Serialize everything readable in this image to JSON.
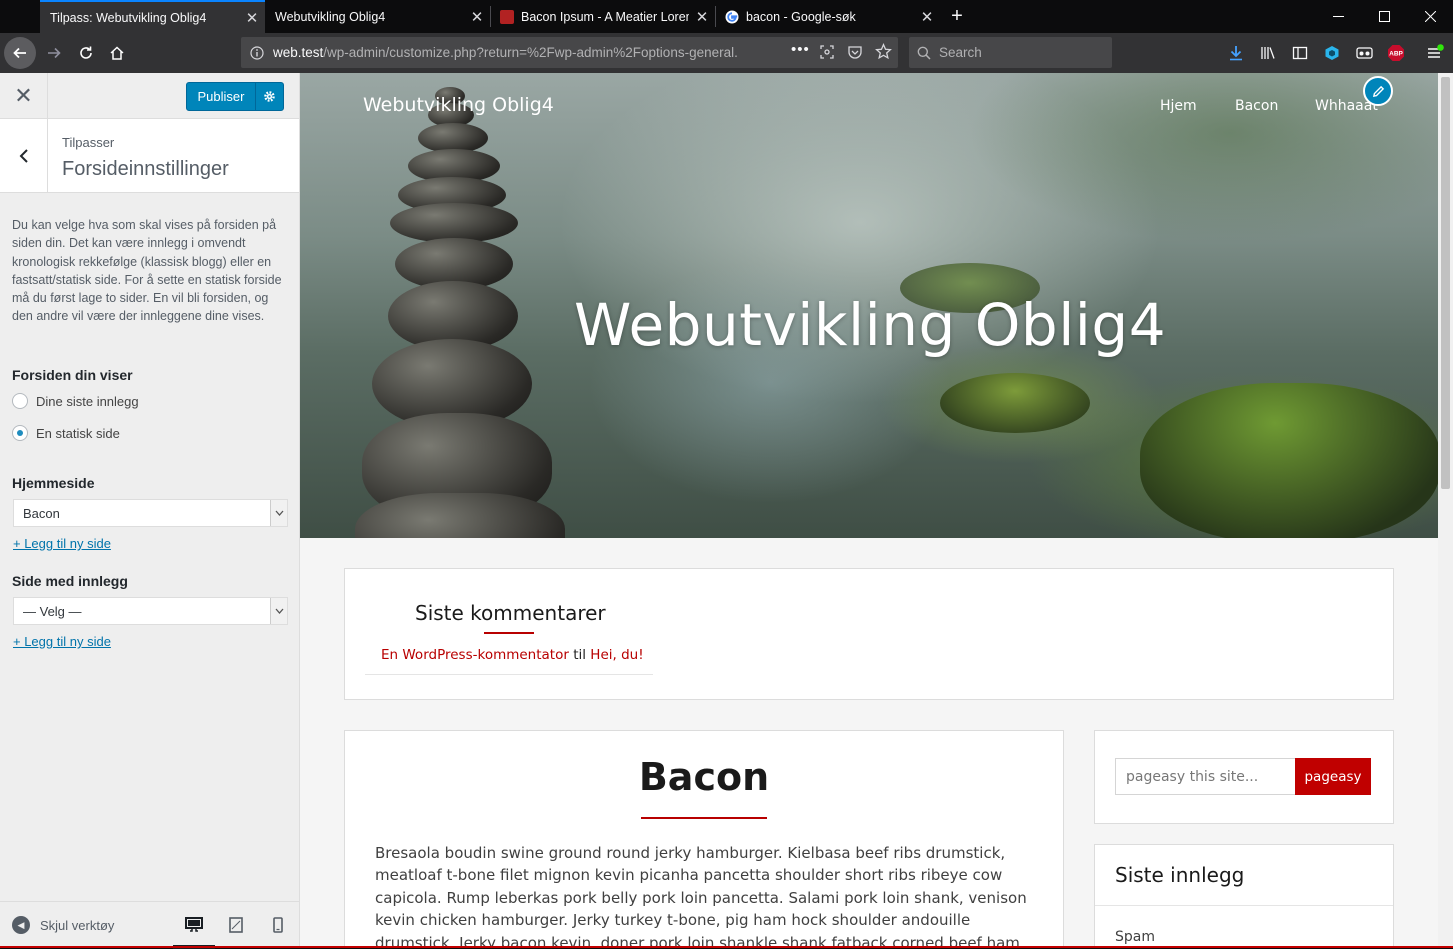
{
  "browser": {
    "tabs": [
      {
        "label": "Tilpass: Webutvikling Oblig4",
        "active": true
      },
      {
        "label": "Webutvikling Oblig4",
        "active": false
      },
      {
        "label": "Bacon Ipsum - A Meatier Lorem",
        "active": false
      },
      {
        "label": "bacon - Google-søk",
        "active": false
      }
    ],
    "url": "web.test/wp-admin/customize.php?return=%2Fwp-admin%2Foptions-general.",
    "url_domain": "web.test",
    "url_path": "/wp-admin/customize.php?return=%2Fwp-admin%2Foptions-general.",
    "search_placeholder": "Search",
    "new_tab_glyph": "+",
    "close_glyph": "✕"
  },
  "customizer": {
    "close_glyph": "✕",
    "publish_label": "Publiser",
    "breadcrumb": "Tilpasser",
    "section_title": "Forsideinnstillinger",
    "description": "Du kan velge hva som skal vises på forsiden på siden din. Det kan være innlegg i omvendt kronologisk rekkefølge (klassisk blogg) eller en fastsatt/statisk side. For å sette en statisk forside må du først lage to sider. En vil bli forsiden, og den andre vil være der innleggene dine vises.",
    "front_label": "Forsiden din viser",
    "radio_latest": "Dine siste innlegg",
    "radio_static": "En statisk side",
    "selected_radio": "static",
    "homepage_label": "Hjemmeside",
    "homepage_value": "Bacon",
    "add_page_link": "+ Legg til ny side",
    "posts_page_label": "Side med innlegg",
    "posts_page_value": "— Velg —",
    "add_page_link_2": "+ Legg til ny side",
    "hide_controls": "Skjul verktøy",
    "active_device": "desktop"
  },
  "site": {
    "site_title": "Webutvikling Oblig4",
    "menu": [
      "Hjem",
      "Bacon",
      "Whhaaat"
    ],
    "hero_title": "Webutvikling Oblig4",
    "recent_comments_title": "Siste kommentarer",
    "comment_author": "En WordPress-kommentator",
    "comment_on": "til",
    "comment_post": "Hei, du!",
    "post_title": "Bacon",
    "post_body": "Bresaola boudin swine ground round jerky hamburger. Kielbasa beef ribs drumstick, meatloaf t-bone filet mignon kevin picanha pancetta shoulder short ribs ribeye cow capicola. Rump leberkas pork belly pork loin pancetta. Salami pork loin shank, venison kevin chicken hamburger. Jerky turkey t-bone, pig ham hock shoulder andouille drumstick. Jerky bacon kevin, doner pork loin shankle shank fatback corned beef ham hock pig turkey picanha.",
    "search_placeholder": "pageasy this site...",
    "search_button": "pageasy",
    "recent_posts_title": "Siste innlegg",
    "recent_post_1": "Spam"
  },
  "colors": {
    "accent_red": "#c00000",
    "wp_blue": "#0085ba",
    "firefox_blue": "#0a84ff"
  }
}
